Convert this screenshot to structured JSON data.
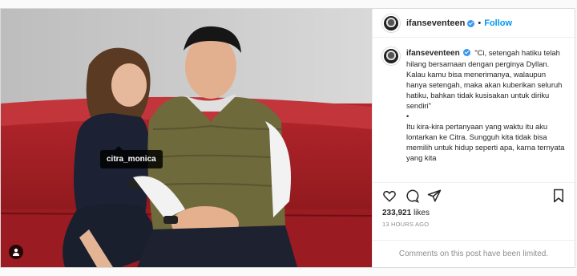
{
  "header": {
    "username": "ifanseventeen",
    "separator": "•",
    "follow_label": "Follow"
  },
  "photo": {
    "tag_label": "citra_monica",
    "icons": [
      "user-tag-icon"
    ]
  },
  "caption": {
    "username": "ifanseventeen",
    "line1": "\"Ci, setengah hatiku telah hilang bersamaan dengan perginya Dyllan. Kalau kamu bisa menerimanya, walaupun hanya setengah, maka akan kuberikan seluruh hatiku, bahkan tidak kusisakan untuk diriku sendiri\"",
    "bullet": "•",
    "line2": "Itu kira-kira pertanyaan yang waktu itu aku lontarkan ke Citra. Sungguh kita tidak bisa memilih untuk hidup seperti apa, karna ternyata yang kita"
  },
  "actions": {
    "icons": [
      "heart-icon",
      "comment-icon",
      "share-icon",
      "bookmark-icon"
    ],
    "likes_count": "233,921",
    "likes_label": "likes",
    "timestamp": "13 HOURS AGO"
  },
  "footer": {
    "limited_text": "Comments on this post have been limited."
  },
  "colors": {
    "follow": "#0095f6",
    "verified": "#3897f0",
    "border": "#dbdbdb",
    "muted": "#8e8e8e"
  }
}
